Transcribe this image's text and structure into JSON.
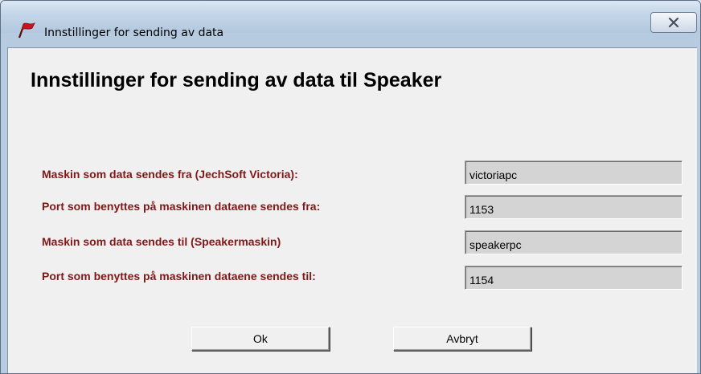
{
  "window": {
    "title": "Innstillinger for sending av data",
    "close_label": "X"
  },
  "dialog": {
    "heading": "Innstillinger for sending av data til Speaker",
    "fields": [
      {
        "label": "Maskin som data sendes fra (JechSoft Victoria):",
        "value": "victoriapc"
      },
      {
        "label": "Port som benyttes på maskinen dataene sendes fra:",
        "value": "1153"
      },
      {
        "label": "Maskin som data sendes til (Speakermaskin)",
        "value": "speakerpc"
      },
      {
        "label": "Port som benyttes på maskinen dataene sendes til:",
        "value": "1154"
      }
    ],
    "buttons": {
      "ok_label": "Ok",
      "cancel_label": "Avbryt"
    }
  },
  "colors": {
    "label_text": "#801818",
    "input_background": "#d4d4d4",
    "client_background": "#f0f0f0",
    "titlebar": "#c2d5e8"
  }
}
